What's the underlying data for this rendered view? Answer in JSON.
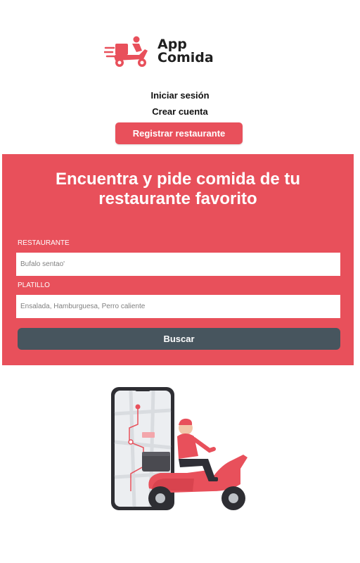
{
  "brand": {
    "line1": "App",
    "line2": "Comida"
  },
  "nav": {
    "login": "Iniciar sesión",
    "create_account": "Crear cuenta",
    "register_restaurant": "Registrar restaurante"
  },
  "hero": {
    "title": "Encuentra y pide comida de tu restaurante favorito",
    "restaurant_label": "RESTAURANTE",
    "restaurant_placeholder": "Bufalo sentao'",
    "dish_label": "PLATILLO",
    "dish_placeholder": "Ensalada, Hamburguesa, Perro caliente",
    "search_button": "Buscar"
  },
  "colors": {
    "brand_red": "#e8505b",
    "button_dark": "#47555e",
    "text_dark": "#1f1f1f"
  },
  "icons": {
    "logo": "delivery-scooter-logo-icon",
    "illustration": "phone-delivery-scooter-illustration"
  }
}
